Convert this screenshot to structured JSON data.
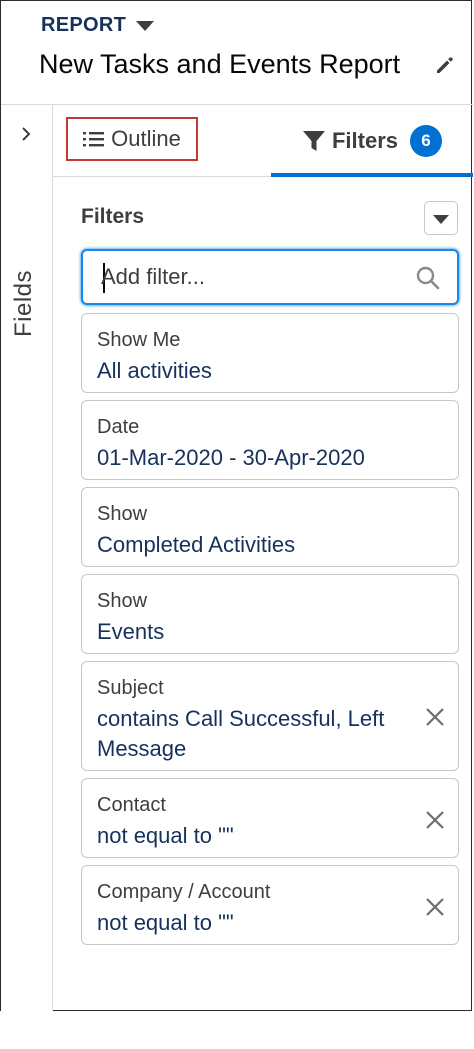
{
  "header": {
    "report_label": "REPORT",
    "title": "New Tasks and Events Report"
  },
  "rail": {
    "label": "Fields"
  },
  "tabs": {
    "outline_label": "Outline",
    "filters_label": "Filters",
    "filters_count": "6"
  },
  "panel": {
    "heading": "Filters",
    "search_placeholder": "Add filter..."
  },
  "filters": [
    {
      "label": "Show Me",
      "value": "All activities",
      "removable": false
    },
    {
      "label": "Date",
      "value": "01-Mar-2020 - 30-Apr-2020",
      "removable": false
    },
    {
      "label": "Show",
      "value": "Completed Activities",
      "removable": false
    },
    {
      "label": "Show",
      "value": "Events",
      "removable": false
    },
    {
      "label": "Subject",
      "value": "contains Call Successful, Left Message",
      "removable": true
    },
    {
      "label": "Contact",
      "value": "not equal to \"\"",
      "removable": true
    },
    {
      "label": "Company / Account",
      "value": "not equal to \"\"",
      "removable": true
    }
  ],
  "icons": {
    "edit": "pencil-icon",
    "rail_toggle": "chevron-right-icon",
    "outline": "list-icon",
    "filters": "funnel-icon",
    "search": "search-icon",
    "remove": "close-icon",
    "menu": "caret-down-icon"
  },
  "colors": {
    "accent": "#0070d2",
    "focus_outline": "#c23934",
    "title_navy": "#16325c"
  }
}
